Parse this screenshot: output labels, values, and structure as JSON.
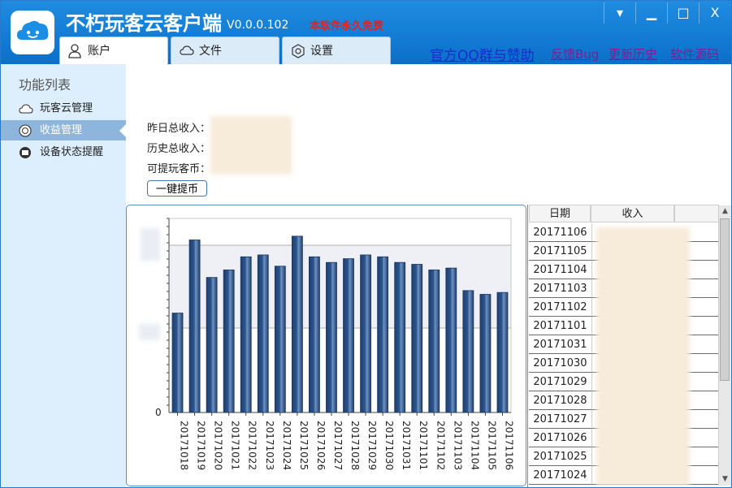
{
  "app": {
    "title": "不朽玩客云客户端",
    "version": "V0.0.0.102",
    "free_note": "本软件永久免费"
  },
  "window_controls": {
    "menu": "▾",
    "minimize": "▁",
    "maximize": "□",
    "close": "X"
  },
  "tabs": [
    {
      "label": "账户"
    },
    {
      "label": "文件"
    },
    {
      "label": "设置"
    }
  ],
  "links": {
    "qq_group": "官方QQ群与赞助",
    "feedback": "反馈Bug",
    "history": "更新历史",
    "source": "软件源码"
  },
  "sidebar": {
    "title": "功能列表",
    "items": [
      {
        "label": "玩客云管理"
      },
      {
        "label": "收益管理"
      },
      {
        "label": "设备状态提醒"
      }
    ]
  },
  "stats": {
    "yesterday_label": "昨日总收入：",
    "total_label": "历史总收入：",
    "withdrawable_label": "可提玩客币："
  },
  "claim_button": "一键提币",
  "chart_data": {
    "type": "bar",
    "categories": [
      "20171018",
      "20171019",
      "20171020",
      "20171021",
      "20171022",
      "20171023",
      "20171024",
      "20171025",
      "20171026",
      "20171027",
      "20171028",
      "20171029",
      "20171030",
      "20171031",
      "20171101",
      "20171102",
      "20171103",
      "20171104",
      "20171105",
      "20171106"
    ],
    "values": [
      0.53,
      0.92,
      0.72,
      0.76,
      0.83,
      0.84,
      0.78,
      0.94,
      0.83,
      0.8,
      0.82,
      0.84,
      0.83,
      0.8,
      0.79,
      0.76,
      0.77,
      0.65,
      0.63,
      0.64
    ],
    "ytick_labels": [
      "0"
    ],
    "grid": true,
    "bar_color": "#2d568e"
  },
  "table": {
    "headers": [
      "日期",
      "收入"
    ],
    "rows": [
      "20171106",
      "20171105",
      "20171104",
      "20171103",
      "20171102",
      "20171101",
      "20171031",
      "20171030",
      "20171029",
      "20171028",
      "20171027",
      "20171026",
      "20171025",
      "20171024"
    ]
  }
}
